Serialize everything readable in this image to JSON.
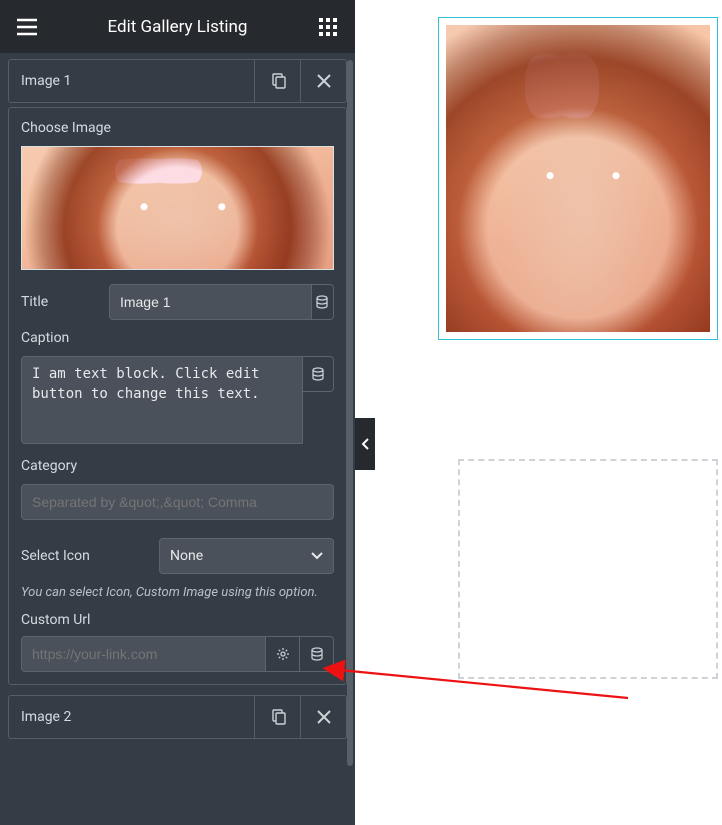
{
  "header": {
    "title": "Edit Gallery Listing"
  },
  "item1": {
    "header": "Image 1",
    "choose_image_label": "Choose Image",
    "title_label": "Title",
    "title_value": "Image 1",
    "caption_label": "Caption",
    "caption_value": "I am text block. Click edit button to change this text.",
    "category_label": "Category",
    "category_placeholder": "Separated by &quot;,&quot; Comma",
    "select_icon_label": "Select Icon",
    "select_icon_value": "None",
    "select_icon_help": "You can select Icon, Custom Image using this option.",
    "custom_url_label": "Custom Url",
    "custom_url_placeholder": "https://your-link.com"
  },
  "item2": {
    "header": "Image 2"
  }
}
